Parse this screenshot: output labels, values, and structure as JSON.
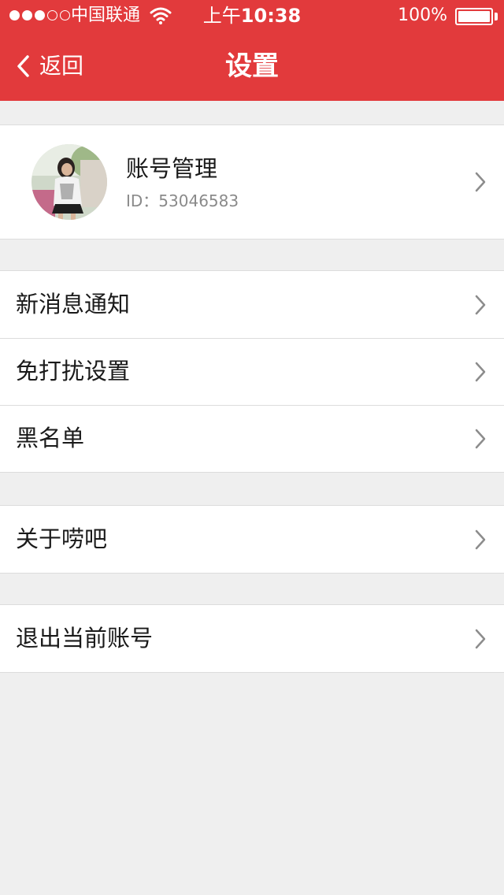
{
  "status_bar": {
    "carrier": "中国联通",
    "time_prefix": "上午",
    "time": "10:38",
    "battery": "100%"
  },
  "nav": {
    "back_label": "返回",
    "title": "设置"
  },
  "account": {
    "name": "账号管理",
    "id_text": "ID：53046583"
  },
  "group1": [
    {
      "label": "新消息通知"
    },
    {
      "label": "免打扰设置"
    },
    {
      "label": "黑名单"
    }
  ],
  "group2": [
    {
      "label": "关于唠吧"
    }
  ],
  "group3": [
    {
      "label": "退出当前账号"
    }
  ],
  "colors": {
    "accent": "#e23a3c",
    "background": "#efefef",
    "divider": "#dcdcdc",
    "chevron": "#8c8c8c"
  }
}
